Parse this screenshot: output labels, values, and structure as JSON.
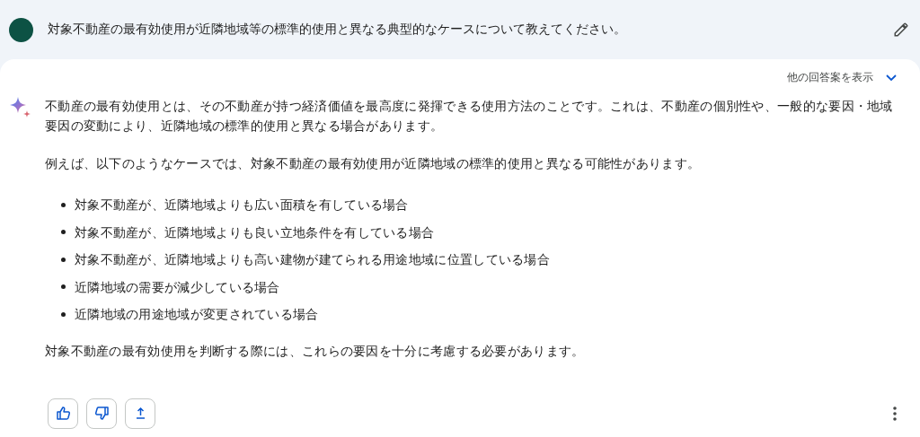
{
  "prompt": {
    "text": "対象不動産の最有効使用が近隣地域等の標準的使用と異なる典型的なケースについて教えてください。"
  },
  "drafts_toggle": {
    "label": "他の回答案を表示",
    "expanded": false
  },
  "response": {
    "paragraphs": [
      "不動産の最有効使用とは、その不動産が持つ経済価値を最高度に発揮できる使用方法のことです。これは、不動産の個別性や、一般的な要因・地域要因の変動により、近隣地域の標準的使用と異なる場合があります。",
      "例えば、以下のようなケースでは、対象不動産の最有効使用が近隣地域の標準的使用と異なる可能性があります。"
    ],
    "bullets": [
      "対象不動産が、近隣地域よりも広い面積を有している場合",
      "対象不動産が、近隣地域よりも良い立地条件を有している場合",
      "対象不動産が、近隣地域よりも高い建物が建てられる用途地域に位置している場合",
      "近隣地域の需要が減少している場合",
      "近隣地域の用途地域が変更されている場合"
    ],
    "conclusion": "対象不動産の最有効使用を判断する際には、これらの要因を十分に考慮する必要があります。"
  },
  "actions": [
    {
      "kind": "like"
    },
    {
      "kind": "dislike"
    },
    {
      "kind": "share"
    }
  ]
}
